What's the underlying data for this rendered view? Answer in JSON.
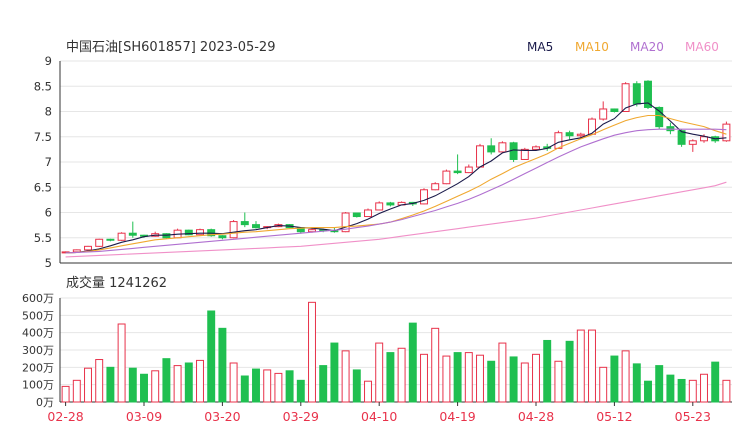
{
  "header": {
    "stock": "中国石油[SH601857] 2023-05-29",
    "ma_labels": [
      {
        "label": "MA5",
        "color": "#1a1a4a"
      },
      {
        "label": "MA10",
        "color": "#f0a830"
      },
      {
        "label": "MA20",
        "color": "#b070d0"
      },
      {
        "label": "MA60",
        "color": "#f090c8"
      }
    ]
  },
  "volume_label": "成交量 1241262",
  "colors": {
    "up": "#e8324a",
    "down": "#1fbf50",
    "grid": "#e6e6e6",
    "axis": "#333333",
    "date_text": "#e8324a"
  },
  "chart_data": [
    {
      "type": "candlestick",
      "ylim": [
        5,
        9
      ],
      "yticks": [
        "9",
        "8.5",
        "8",
        "7.5",
        "7",
        "6.5",
        "6",
        "5.5",
        "5"
      ],
      "xtick_labels": [
        {
          "label": "02-28",
          "index": 0
        },
        {
          "label": "03-09",
          "index": 7
        },
        {
          "label": "03-20",
          "index": 14
        },
        {
          "label": "03-29",
          "index": 21
        },
        {
          "label": "04-10",
          "index": 28
        },
        {
          "label": "04-19",
          "index": 35
        },
        {
          "label": "04-28",
          "index": 42
        },
        {
          "label": "05-12",
          "index": 49
        },
        {
          "label": "05-23",
          "index": 56
        }
      ],
      "ohlc": [
        [
          5.2,
          5.23,
          5.19,
          5.22
        ],
        [
          5.22,
          5.27,
          5.21,
          5.26
        ],
        [
          5.26,
          5.34,
          5.25,
          5.33
        ],
        [
          5.33,
          5.48,
          5.32,
          5.47
        ],
        [
          5.47,
          5.48,
          5.43,
          5.45
        ],
        [
          5.45,
          5.61,
          5.44,
          5.59
        ],
        [
          5.59,
          5.82,
          5.5,
          5.55
        ],
        [
          5.55,
          5.56,
          5.5,
          5.53
        ],
        [
          5.53,
          5.62,
          5.52,
          5.58
        ],
        [
          5.58,
          5.59,
          5.48,
          5.5
        ],
        [
          5.5,
          5.68,
          5.49,
          5.65
        ],
        [
          5.65,
          5.66,
          5.55,
          5.56
        ],
        [
          5.56,
          5.68,
          5.55,
          5.66
        ],
        [
          5.66,
          5.68,
          5.52,
          5.54
        ],
        [
          5.54,
          5.55,
          5.47,
          5.5
        ],
        [
          5.5,
          5.85,
          5.49,
          5.82
        ],
        [
          5.82,
          6.0,
          5.71,
          5.76
        ],
        [
          5.76,
          5.83,
          5.68,
          5.7
        ],
        [
          5.7,
          5.73,
          5.67,
          5.72
        ],
        [
          5.72,
          5.78,
          5.71,
          5.76
        ],
        [
          5.76,
          5.77,
          5.69,
          5.7
        ],
        [
          5.7,
          5.71,
          5.58,
          5.62
        ],
        [
          5.62,
          5.68,
          5.6,
          5.66
        ],
        [
          5.66,
          5.68,
          5.61,
          5.64
        ],
        [
          5.64,
          5.7,
          5.6,
          5.62
        ],
        [
          5.62,
          6.01,
          5.61,
          5.99
        ],
        [
          5.99,
          6.0,
          5.9,
          5.92
        ],
        [
          5.92,
          6.08,
          5.91,
          6.05
        ],
        [
          6.05,
          6.22,
          6.04,
          6.19
        ],
        [
          6.19,
          6.21,
          6.12,
          6.15
        ],
        [
          6.15,
          6.22,
          6.14,
          6.2
        ],
        [
          6.2,
          6.21,
          6.13,
          6.17
        ],
        [
          6.17,
          6.48,
          6.16,
          6.45
        ],
        [
          6.45,
          6.6,
          6.44,
          6.57
        ],
        [
          6.57,
          6.85,
          6.56,
          6.82
        ],
        [
          6.82,
          7.15,
          6.76,
          6.79
        ],
        [
          6.79,
          6.95,
          6.78,
          6.9
        ],
        [
          6.9,
          7.36,
          6.89,
          7.32
        ],
        [
          7.32,
          7.47,
          7.15,
          7.2
        ],
        [
          7.2,
          7.41,
          7.19,
          7.38
        ],
        [
          7.38,
          7.4,
          7.0,
          7.05
        ],
        [
          7.05,
          7.28,
          7.04,
          7.25
        ],
        [
          7.25,
          7.33,
          7.24,
          7.3
        ],
        [
          7.3,
          7.36,
          7.22,
          7.27
        ],
        [
          7.27,
          7.62,
          7.26,
          7.58
        ],
        [
          7.58,
          7.62,
          7.45,
          7.52
        ],
        [
          7.52,
          7.58,
          7.46,
          7.55
        ],
        [
          7.55,
          7.88,
          7.54,
          7.85
        ],
        [
          7.85,
          8.2,
          7.82,
          8.05
        ],
        [
          8.05,
          8.06,
          7.98,
          8.0
        ],
        [
          8.0,
          8.58,
          7.99,
          8.55
        ],
        [
          8.55,
          8.6,
          8.1,
          8.15
        ],
        [
          8.6,
          8.62,
          8.05,
          8.08
        ],
        [
          8.08,
          8.1,
          7.65,
          7.7
        ],
        [
          7.7,
          7.78,
          7.55,
          7.62
        ],
        [
          7.62,
          7.65,
          7.3,
          7.35
        ],
        [
          7.35,
          7.45,
          7.2,
          7.42
        ],
        [
          7.42,
          7.55,
          7.38,
          7.5
        ],
        [
          7.5,
          7.52,
          7.38,
          7.42
        ],
        [
          7.42,
          7.8,
          7.4,
          7.75
        ]
      ],
      "ma": [
        {
          "name": "MA5",
          "color": "#1a1a4a",
          "values": [
            5.2,
            5.21,
            5.24,
            5.28,
            5.34,
            5.41,
            5.46,
            5.52,
            5.55,
            5.55,
            5.57,
            5.58,
            5.59,
            5.59,
            5.58,
            5.61,
            5.64,
            5.66,
            5.7,
            5.74,
            5.73,
            5.7,
            5.69,
            5.67,
            5.64,
            5.71,
            5.78,
            5.87,
            5.98,
            6.07,
            6.15,
            6.18,
            6.24,
            6.33,
            6.45,
            6.57,
            6.71,
            6.9,
            7.02,
            7.18,
            7.24,
            7.23,
            7.23,
            7.27,
            7.39,
            7.44,
            7.48,
            7.57,
            7.75,
            7.86,
            8.07,
            8.15,
            8.17,
            8.01,
            7.81,
            7.6,
            7.55,
            7.51,
            7.46,
            7.48
          ]
        },
        {
          "name": "MA10",
          "color": "#f0a830",
          "values": [
            5.2,
            5.21,
            5.23,
            5.26,
            5.3,
            5.34,
            5.38,
            5.42,
            5.46,
            5.48,
            5.5,
            5.52,
            5.54,
            5.56,
            5.57,
            5.59,
            5.61,
            5.62,
            5.64,
            5.66,
            5.68,
            5.69,
            5.7,
            5.7,
            5.7,
            5.72,
            5.73,
            5.75,
            5.77,
            5.81,
            5.88,
            5.95,
            6.03,
            6.12,
            6.22,
            6.32,
            6.42,
            6.53,
            6.66,
            6.77,
            6.89,
            6.98,
            7.07,
            7.16,
            7.28,
            7.37,
            7.46,
            7.54,
            7.64,
            7.73,
            7.82,
            7.88,
            7.92,
            7.92,
            7.86,
            7.8,
            7.75,
            7.7,
            7.62,
            7.55
          ]
        },
        {
          "name": "MA20",
          "color": "#b070d0",
          "values": [
            5.2,
            5.21,
            5.22,
            5.23,
            5.25,
            5.27,
            5.29,
            5.31,
            5.33,
            5.35,
            5.37,
            5.39,
            5.41,
            5.43,
            5.45,
            5.47,
            5.49,
            5.51,
            5.53,
            5.55,
            5.57,
            5.59,
            5.61,
            5.63,
            5.65,
            5.67,
            5.7,
            5.73,
            5.77,
            5.81,
            5.86,
            5.92,
            5.98,
            6.04,
            6.11,
            6.18,
            6.26,
            6.35,
            6.45,
            6.55,
            6.66,
            6.77,
            6.88,
            6.99,
            7.1,
            7.2,
            7.3,
            7.38,
            7.46,
            7.53,
            7.58,
            7.62,
            7.64,
            7.65,
            7.65,
            7.65,
            7.65,
            7.65,
            7.65,
            7.64
          ]
        },
        {
          "name": "MA60",
          "color": "#f090c8",
          "values": [
            5.12,
            5.13,
            5.14,
            5.15,
            5.16,
            5.17,
            5.18,
            5.19,
            5.2,
            5.21,
            5.22,
            5.23,
            5.24,
            5.25,
            5.26,
            5.27,
            5.28,
            5.29,
            5.3,
            5.31,
            5.32,
            5.33,
            5.35,
            5.37,
            5.39,
            5.41,
            5.43,
            5.45,
            5.47,
            5.5,
            5.53,
            5.56,
            5.59,
            5.62,
            5.65,
            5.68,
            5.71,
            5.74,
            5.77,
            5.8,
            5.83,
            5.86,
            5.89,
            5.93,
            5.97,
            6.01,
            6.05,
            6.09,
            6.13,
            6.17,
            6.21,
            6.25,
            6.29,
            6.33,
            6.37,
            6.41,
            6.45,
            6.49,
            6.53,
            6.6
          ]
        }
      ]
    },
    {
      "type": "bar",
      "title": "成交量 1241262",
      "unit": "万",
      "ylim": [
        0,
        600
      ],
      "yticks": [
        "600万",
        "500万",
        "400万",
        "300万",
        "200万",
        "100万",
        "0万"
      ],
      "values": [
        90,
        125,
        195,
        245,
        200,
        450,
        195,
        160,
        180,
        250,
        210,
        225,
        240,
        525,
        425,
        225,
        150,
        190,
        185,
        165,
        180,
        125,
        575,
        210,
        340,
        295,
        185,
        120,
        340,
        285,
        310,
        455,
        275,
        425,
        265,
        285,
        285,
        270,
        235,
        340,
        260,
        225,
        275,
        355,
        235,
        350,
        415,
        415,
        200,
        265,
        295,
        220,
        120,
        210,
        155,
        130,
        125,
        160,
        230,
        125
      ]
    }
  ]
}
